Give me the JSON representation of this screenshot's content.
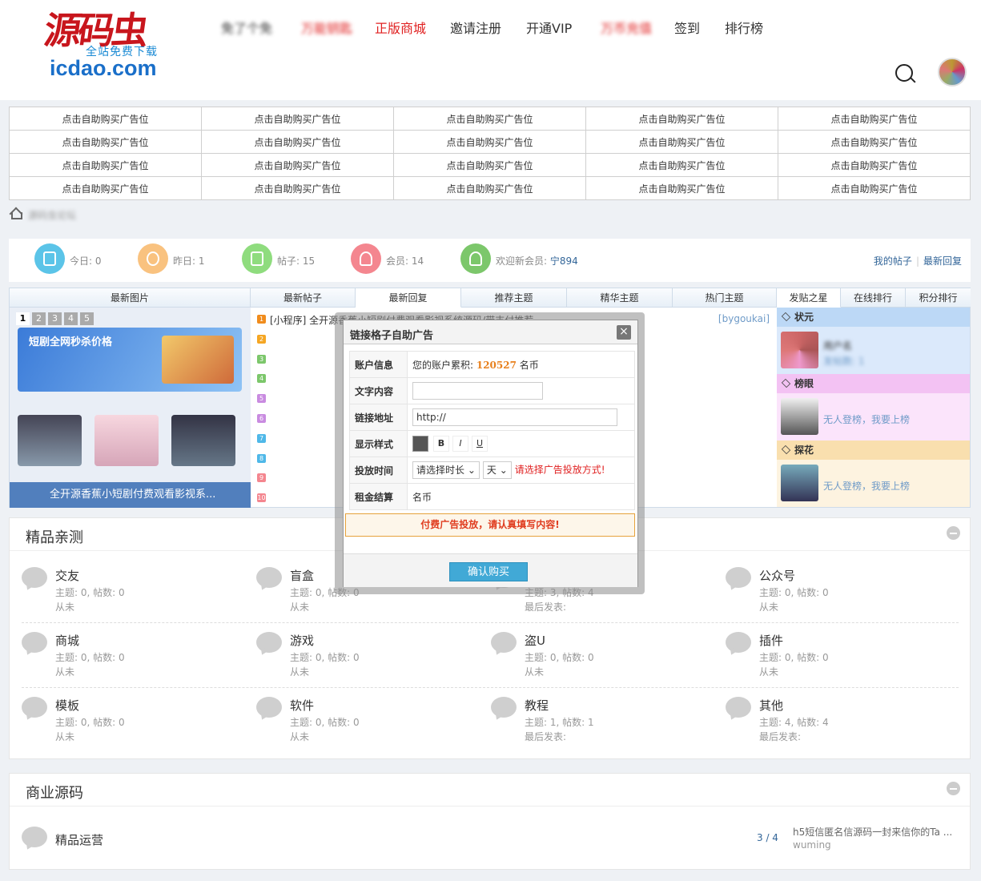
{
  "header": {
    "logo": {
      "mark": "源码虫",
      "subtitle": "全站免费下载",
      "domain": "icdao.com"
    },
    "nav": [
      {
        "label": "免了个免",
        "style": "blur"
      },
      {
        "label": "万能钥匙",
        "style": "red-blur"
      },
      {
        "label": "正版商城",
        "style": "red"
      },
      {
        "label": "邀请注册",
        "style": "normal"
      },
      {
        "label": "开通VIP",
        "style": "normal"
      },
      {
        "label": "万币充值",
        "style": "red-blur"
      },
      {
        "label": "签到",
        "style": "normal"
      },
      {
        "label": "排行榜",
        "style": "normal"
      }
    ]
  },
  "ads": {
    "cell_label": "点击自助购买广告位",
    "first_cell_last_row": "点击自助购买广告位"
  },
  "breadcrumb": {
    "text": "源码虫论坛"
  },
  "stats": {
    "today": "今日: 0",
    "yesterday": "昨日: 1",
    "posts": "帖子: 15",
    "members": "会员: 14",
    "welcome_label": "欢迎新会员: ",
    "welcome_name": "宁894",
    "my_posts": "我的帖子",
    "latest_reply": "最新回复",
    "colors": {
      "today": "#5bc4e8",
      "yesterday": "#f9c27f",
      "posts": "#8fdc7e",
      "members": "#f4868f",
      "welcome": "#7cc76b"
    }
  },
  "tabs": {
    "headers": [
      "最新图片",
      "最新帖子",
      "最新回复",
      "推荐主题",
      "精华主题",
      "热门主题"
    ],
    "side_headers": [
      "发贴之星",
      "在线排行",
      "积分排行"
    ],
    "slider": {
      "pages": [
        "1",
        "2",
        "3",
        "4",
        "5"
      ],
      "banner": "短剧全网秒杀价格",
      "caption": "全开源香蕉小短剧付费观看影视系..."
    },
    "list": [
      {
        "num": "1",
        "title": "[小程序] 全开源香蕉小短剧付费观看影视系统源码/带支付推荐...",
        "author": "[bygoukai]",
        "color": "#f08c1d"
      },
      {
        "num": "2",
        "title": "",
        "author": "",
        "color": "#f5a623"
      },
      {
        "num": "3",
        "title": "",
        "author": "",
        "color": "#7cc76b"
      },
      {
        "num": "4",
        "title": "",
        "author": "",
        "color": "#7cc76b"
      },
      {
        "num": "5",
        "title": "",
        "author": "",
        "color": "#c98be0"
      },
      {
        "num": "6",
        "title": "",
        "author": "",
        "color": "#c98be0"
      },
      {
        "num": "7",
        "title": "",
        "author": "",
        "color": "#4fb8e8"
      },
      {
        "num": "8",
        "title": "",
        "author": "",
        "color": "#4fb8e8"
      },
      {
        "num": "9",
        "title": "",
        "author": "",
        "color": "#f4868f"
      },
      {
        "num": "10",
        "title": "",
        "author": "",
        "color": "#f4868f"
      }
    ],
    "side": [
      {
        "rank": "状元",
        "line1": "用户名",
        "line2": "发帖数: 1",
        "bg": "#dbe9fb",
        "hbg": "#bcd8f6"
      },
      {
        "rank": "榜眼",
        "line1": "无人登榜，我要上榜",
        "line2": "",
        "bg": "#fbe4fb",
        "hbg": "#f3c2f3"
      },
      {
        "rank": "探花",
        "line1": "无人登榜，我要上榜",
        "line2": "",
        "bg": "#fdf3e0",
        "hbg": "#f9dfae"
      }
    ]
  },
  "section1": {
    "title": "精品亲测",
    "forums": [
      {
        "name": "交友",
        "meta1": "主题: 0, 帖数: 0",
        "meta2": "从未"
      },
      {
        "name": "盲盒",
        "meta1": "主题: 0, 帖数: 0",
        "meta2": "从未"
      },
      {
        "name": "",
        "meta1": "主题: 3, 帖数: 4",
        "meta2": "最后发表:"
      },
      {
        "name": "公众号",
        "meta1": "主题: 0, 帖数: 0",
        "meta2": "从未"
      },
      {
        "name": "商城",
        "meta1": "主题: 0, 帖数: 0",
        "meta2": "从未"
      },
      {
        "name": "游戏",
        "meta1": "主题: 0, 帖数: 0",
        "meta2": "从未"
      },
      {
        "name": "盗U",
        "meta1": "主题: 0, 帖数: 0",
        "meta2": "从未"
      },
      {
        "name": "插件",
        "meta1": "主题: 0, 帖数: 0",
        "meta2": "从未"
      },
      {
        "name": "模板",
        "meta1": "主题: 0, 帖数: 0",
        "meta2": "从未"
      },
      {
        "name": "软件",
        "meta1": "主题: 0, 帖数: 0",
        "meta2": "从未"
      },
      {
        "name": "教程",
        "meta1": "主题: 1, 帖数: 1",
        "meta2": "最后发表:"
      },
      {
        "name": "其他",
        "meta1": "主题: 4, 帖数: 4",
        "meta2": "最后发表:"
      }
    ]
  },
  "section2": {
    "title": "商业源码",
    "forum": {
      "name": "精品运营",
      "count": "3 / 4",
      "last_title": "h5短信匿名信源码一封来信你的Ta ...",
      "last_author": "wuming"
    }
  },
  "modal": {
    "title": "链接格子自助广告",
    "close": "×",
    "rows": {
      "account_label": "账户信息",
      "account_prefix": "您的账户累积: ",
      "account_amount": "120527",
      "account_unit": " 名币",
      "text_label": "文字内容",
      "text_value": "",
      "link_label": "链接地址",
      "link_value": "http://",
      "style_label": "显示样式",
      "bold": "B",
      "italic": "I",
      "underline": "U",
      "time_label": "投放时间",
      "duration_placeholder": "请选择时长",
      "unit_option": "天",
      "time_hint": "请选择广告投放方式!",
      "rent_label": "租金结算",
      "rent_value": "名币"
    },
    "warning": "付费广告投放，请认真填写内容!",
    "confirm": "确认购买"
  }
}
